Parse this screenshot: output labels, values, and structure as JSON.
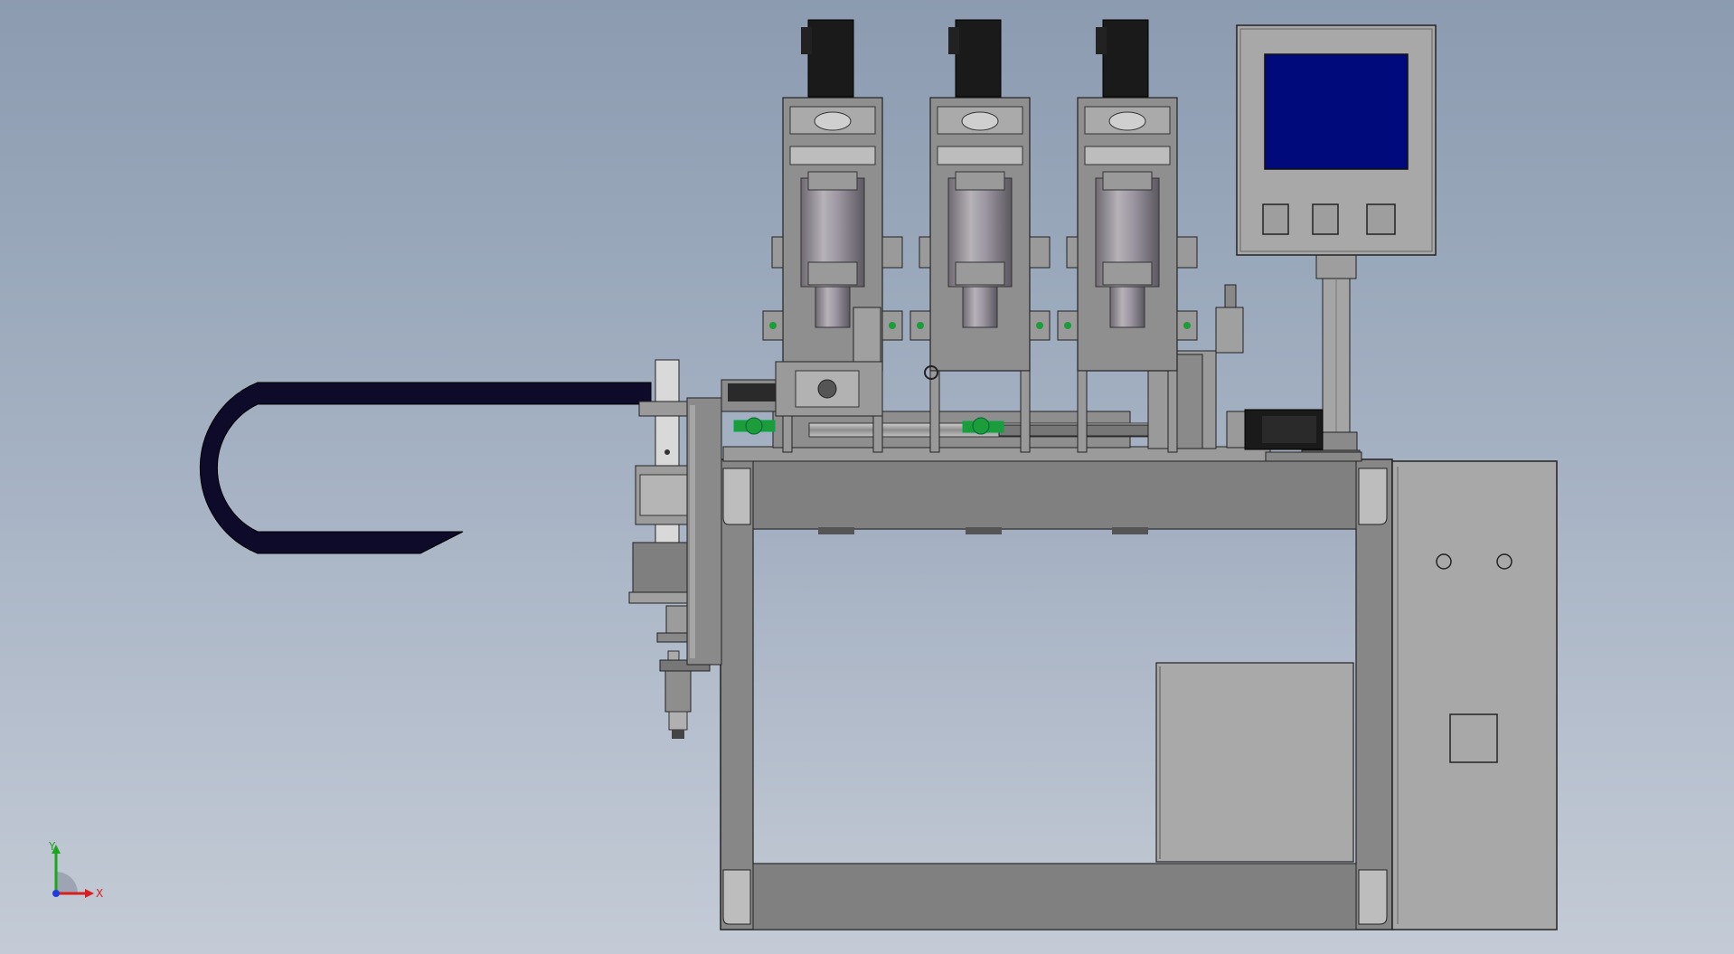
{
  "triad": {
    "x_label": "X",
    "y_label": "Y",
    "x_color": "#d81e1e",
    "y_color": "#1ea51e",
    "z_color": "#1e3cd8"
  },
  "colors": {
    "background_top": "#8c9bb0",
    "background_bottom": "#c4cbd6",
    "frame": "#7d7d7d",
    "panel": "#a8a8a8",
    "hmi_screen": "#000a7a",
    "motor": "#1a1a1a",
    "cable_chain": "#0d0a2a",
    "accent_green": "#1c9c3a"
  }
}
